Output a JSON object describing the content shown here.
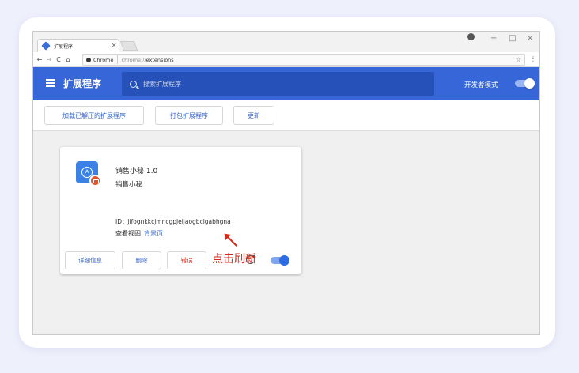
{
  "tab": {
    "title": "扩展程序"
  },
  "window_controls": {
    "minimize": "−",
    "maximize": "□",
    "close": "×"
  },
  "address": {
    "site": "Chrome",
    "scheme": "chrome://",
    "path": "extensions"
  },
  "header": {
    "title": "扩展程序",
    "search_placeholder": "搜索扩展程序",
    "developer_mode_label": "开发者模式",
    "developer_mode_on": true
  },
  "toolbar": {
    "load_unpacked": "加载已解压的扩展程序",
    "pack": "打包扩展程序",
    "update": "更新"
  },
  "extension": {
    "name": "销售小秘 1.0",
    "description": "销售小秘",
    "id": "ID：jifognkkcjmncgpjeijaogbclgabhgna",
    "views_label": "查看视图",
    "views_link": "背景页",
    "details_button": "详细信息",
    "remove_button": "删除",
    "errors_button": "错误",
    "enabled": true
  },
  "annotation": {
    "text": "点击刷新",
    "color": "#d6281c"
  },
  "colors": {
    "header": "#3666d8",
    "link": "#3a66c8",
    "error": "#d6281c"
  }
}
